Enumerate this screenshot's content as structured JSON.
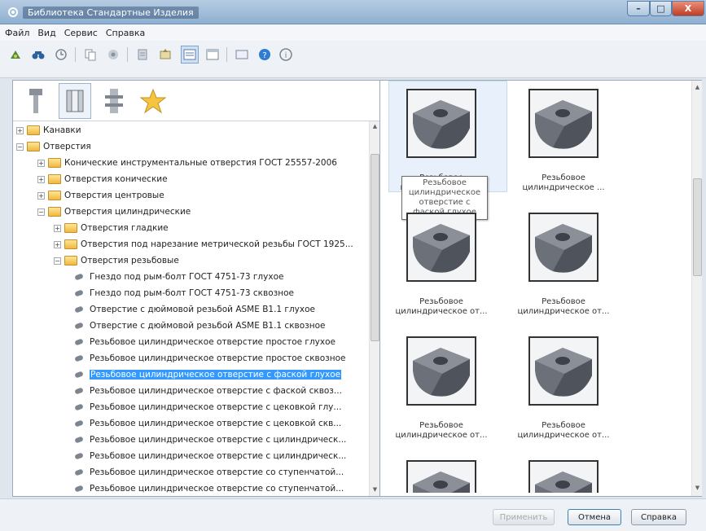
{
  "window": {
    "title": "Библиотека Стандартные Изделия",
    "min": "–",
    "max": "□",
    "close": "X"
  },
  "menu": [
    "Файл",
    "Вид",
    "Сервис",
    "Справка"
  ],
  "toolbar": {
    "active_color": "#cfe0f4"
  },
  "tree": {
    "nodes": [
      {
        "label": "Канавки",
        "exp": "+"
      },
      {
        "label": "Отверстия",
        "exp": "−"
      },
      {
        "label": "Конические инструментальные отверстия ГОСТ 25557-2006",
        "exp": "+"
      },
      {
        "label": "Отверстия конические",
        "exp": "+"
      },
      {
        "label": "Отверстия центровые",
        "exp": "+"
      },
      {
        "label": "Отверстия цилиндрические",
        "exp": "−"
      },
      {
        "label": "Отверстия гладкие",
        "exp": "+"
      },
      {
        "label": "Отверстия под нарезание метрической резьбы ГОСТ 1925...",
        "exp": "+"
      },
      {
        "label": "Отверстия резьбовые",
        "exp": "−"
      },
      {
        "label": "Гнездо под рым-болт ГОСТ 4751-73 глухое"
      },
      {
        "label": "Гнездо под рым-болт ГОСТ 4751-73 сквозное"
      },
      {
        "label": "Отверстие с дюймовой резьбой ASME B1.1 глухое"
      },
      {
        "label": "Отверстие с дюймовой резьбой ASME B1.1 сквозное"
      },
      {
        "label": "Резьбовое цилиндрическое отверстие простое глухое"
      },
      {
        "label": "Резьбовое цилиндрическое отверстие простое сквозное"
      },
      {
        "label": "Резьбовое цилиндрическое отверстие с фаской глухое"
      },
      {
        "label": "Резьбовое цилиндрическое отверстие с фаской сквоз..."
      },
      {
        "label": "Резьбовое цилиндрическое отверстие с цековкой глу..."
      },
      {
        "label": "Резьбовое цилиндрическое отверстие с цековкой скв..."
      },
      {
        "label": "Резьбовое цилиндрическое отверстие с цилиндрическ..."
      },
      {
        "label": "Резьбовое цилиндрическое отверстие с цилиндрическ..."
      },
      {
        "label": "Резьбовое цилиндрическое отверстие со ступенчатой..."
      },
      {
        "label": "Резьбовое цилиндрическое отверстие со ступенчатой..."
      }
    ]
  },
  "gallery": {
    "cards": [
      {
        "caption": "Резьбовое\nцилиндрическое ..."
      },
      {
        "caption": "Резьбовое\nцилиндрическое ..."
      },
      {
        "caption": "Резьбовое\nцилиндрическое от..."
      },
      {
        "caption": "Резьбовое\nцилиндрическое от..."
      },
      {
        "caption": "Резьбовое\nцилиндрическое от..."
      },
      {
        "caption": "Резьбовое\nцилиндрическое от..."
      }
    ],
    "tooltip": "Резьбовое цилиндрическое отверстие с фаской глухое"
  },
  "footer": {
    "apply": "Применить",
    "cancel": "Отмена",
    "help": "Справка"
  }
}
